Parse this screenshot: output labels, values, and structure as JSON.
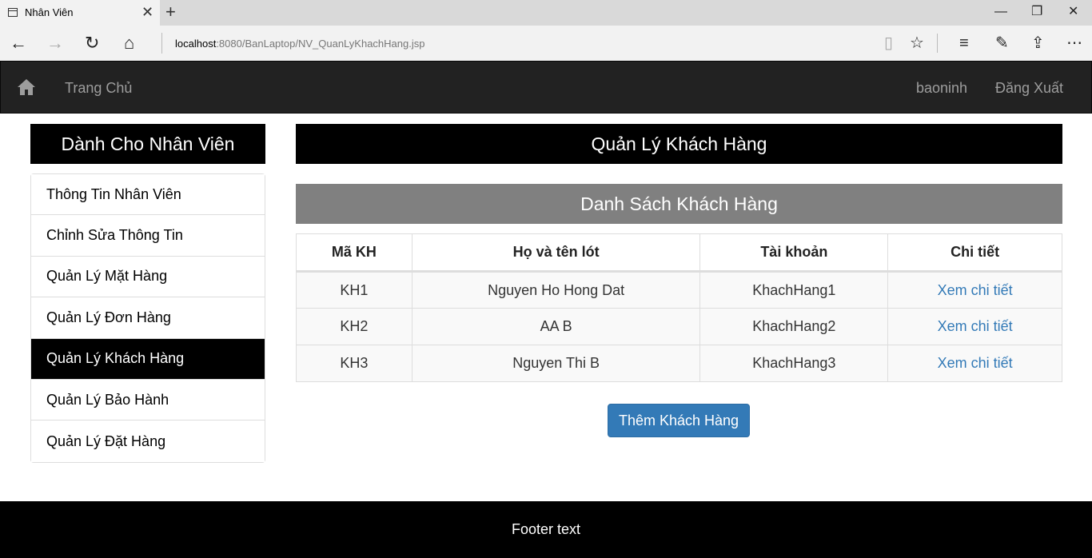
{
  "browser": {
    "tab_title": "Nhân Viên",
    "url_host": "localhost",
    "url_rest": ":8080/BanLaptop/NV_QuanLyKhachHang.jsp"
  },
  "navbar": {
    "home": "Trang Chủ",
    "user": "baoninh",
    "logout": "Đăng Xuất"
  },
  "sidebar": {
    "title": "Dành Cho Nhân Viên",
    "items": [
      {
        "label": "Thông Tin Nhân Viên"
      },
      {
        "label": "Chỉnh Sửa Thông Tin"
      },
      {
        "label": "Quản Lý Mặt Hàng"
      },
      {
        "label": "Quản Lý Đơn Hàng"
      },
      {
        "label": "Quản Lý Khách Hàng"
      },
      {
        "label": "Quản Lý Bảo Hành"
      },
      {
        "label": "Quản Lý Đặt Hàng"
      }
    ]
  },
  "main": {
    "title": "Quản Lý Khách Hàng",
    "subtitle": "Danh Sách Khách Hàng",
    "columns": [
      "Mã KH",
      "Họ và tên lót",
      "Tài khoản",
      "Chi tiết"
    ],
    "rows": [
      {
        "id": "KH1",
        "name": "Nguyen Ho Hong Dat",
        "account": "KhachHang1",
        "detail": "Xem chi tiết"
      },
      {
        "id": "KH2",
        "name": "AA B",
        "account": "KhachHang2",
        "detail": "Xem chi tiết"
      },
      {
        "id": "KH3",
        "name": "Nguyen Thi B",
        "account": "KhachHang3",
        "detail": "Xem chi tiết"
      }
    ],
    "add_button": "Thêm Khách Hàng"
  },
  "footer": {
    "text": "Footer text"
  }
}
